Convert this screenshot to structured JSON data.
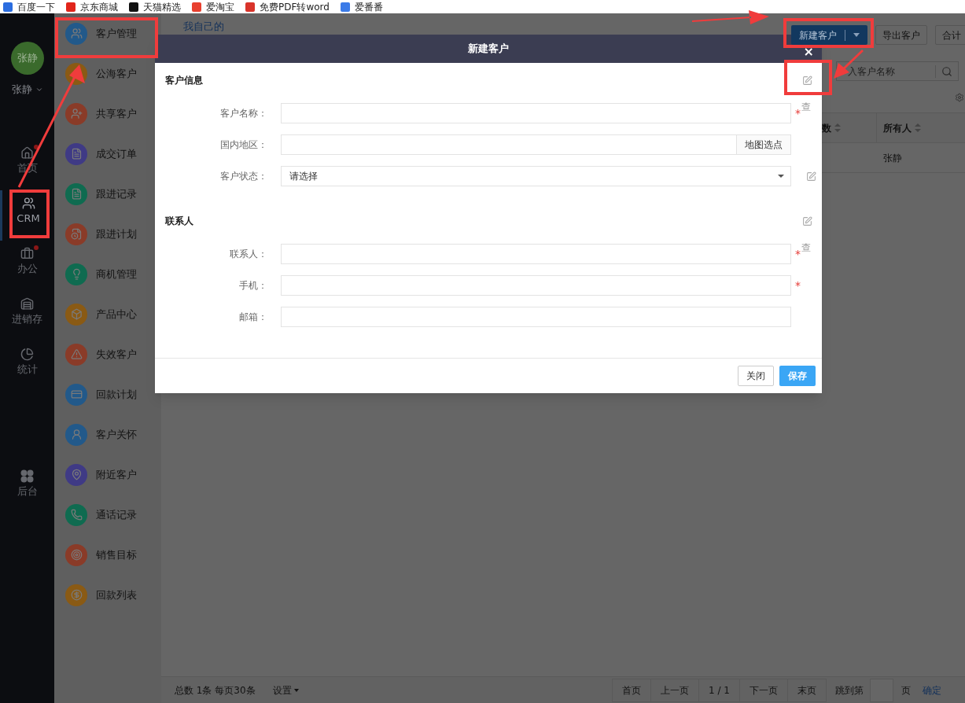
{
  "bookmarks": [
    {
      "label": "百度一下"
    },
    {
      "label": "京东商城"
    },
    {
      "label": "天猫精选"
    },
    {
      "label": "爱淘宝"
    },
    {
      "label": "免费PDF转word"
    },
    {
      "label": "爱番番"
    }
  ],
  "sidebar": {
    "avatar": "张静",
    "user_name": "张静",
    "items": [
      {
        "label": "首页",
        "dot": true,
        "selected": false
      },
      {
        "label": "CRM",
        "dot": false,
        "selected": true
      },
      {
        "label": "办公",
        "dot": true,
        "selected": false
      },
      {
        "label": "进销存",
        "dot": false,
        "selected": false
      },
      {
        "label": "统计",
        "dot": false,
        "selected": false
      }
    ],
    "admin_item": {
      "label": "后台",
      "dot": false,
      "selected": false
    }
  },
  "menu": [
    {
      "label": "客户管理",
      "color": "#22598a"
    },
    {
      "label": "公海客户",
      "color": "#8a5a14"
    },
    {
      "label": "共享客户",
      "color": "#8a3b28"
    },
    {
      "label": "成交订单",
      "color": "#3f3a85"
    },
    {
      "label": "跟进记录",
      "color": "#0f6b50"
    },
    {
      "label": "跟进计划",
      "color": "#8a3b28"
    },
    {
      "label": "商机管理",
      "color": "#0f6b50"
    },
    {
      "label": "产品中心",
      "color": "#8a5a14"
    },
    {
      "label": "失效客户",
      "color": "#8a3b28"
    },
    {
      "label": "回款计划",
      "color": "#22598a"
    },
    {
      "label": "客户关怀",
      "color": "#22598a"
    },
    {
      "label": "附近客户",
      "color": "#3f3a85"
    },
    {
      "label": "通话记录",
      "color": "#0f6b50"
    },
    {
      "label": "销售目标",
      "color": "#8a3b28"
    },
    {
      "label": "回款列表",
      "color": "#8a5a14"
    }
  ],
  "main": {
    "tab": "我自己的",
    "actions": [
      {
        "label": "新建客户",
        "kind": "split"
      },
      {
        "label": "导出客户",
        "kind": "plain"
      },
      {
        "label": "合计",
        "kind": "plain"
      }
    ],
    "search": {
      "placeholder": "入客户名称"
    },
    "table": {
      "columns": [
        {
          "label": "数"
        },
        {
          "label": "所有人"
        }
      ],
      "rows": [
        {
          "owner": "张静"
        }
      ]
    },
    "footer": {
      "summary": "总数 1条 每页30条",
      "settings": "设置",
      "pages": [
        "首页",
        "上一页",
        "1 / 1",
        "下一页",
        "末页"
      ],
      "jump_label": "跳到第",
      "page_unit": "页",
      "confirm": "确定"
    }
  },
  "modal": {
    "title": "新建客户",
    "close": "×",
    "sections": [
      {
        "title": "客户信息",
        "fields": [
          {
            "label": "客户名称：",
            "kind": "text",
            "required_mark": "*",
            "lookup": "查"
          },
          {
            "label": "国内地区：",
            "kind": "map",
            "button": "地图选点"
          },
          {
            "label": "客户状态：",
            "kind": "select",
            "placeholder": "请选择",
            "edit": true
          }
        ]
      },
      {
        "title": "联系人",
        "fields": [
          {
            "label": "联系人：",
            "kind": "text",
            "required_mark": "*",
            "lookup": "查"
          },
          {
            "label": "手机：",
            "kind": "text",
            "required_mark": "*"
          },
          {
            "label": "邮箱：",
            "kind": "text"
          }
        ]
      }
    ],
    "buttons": [
      {
        "label": "关闭",
        "kind": "secondary"
      },
      {
        "label": "保存",
        "kind": "primary"
      }
    ]
  }
}
